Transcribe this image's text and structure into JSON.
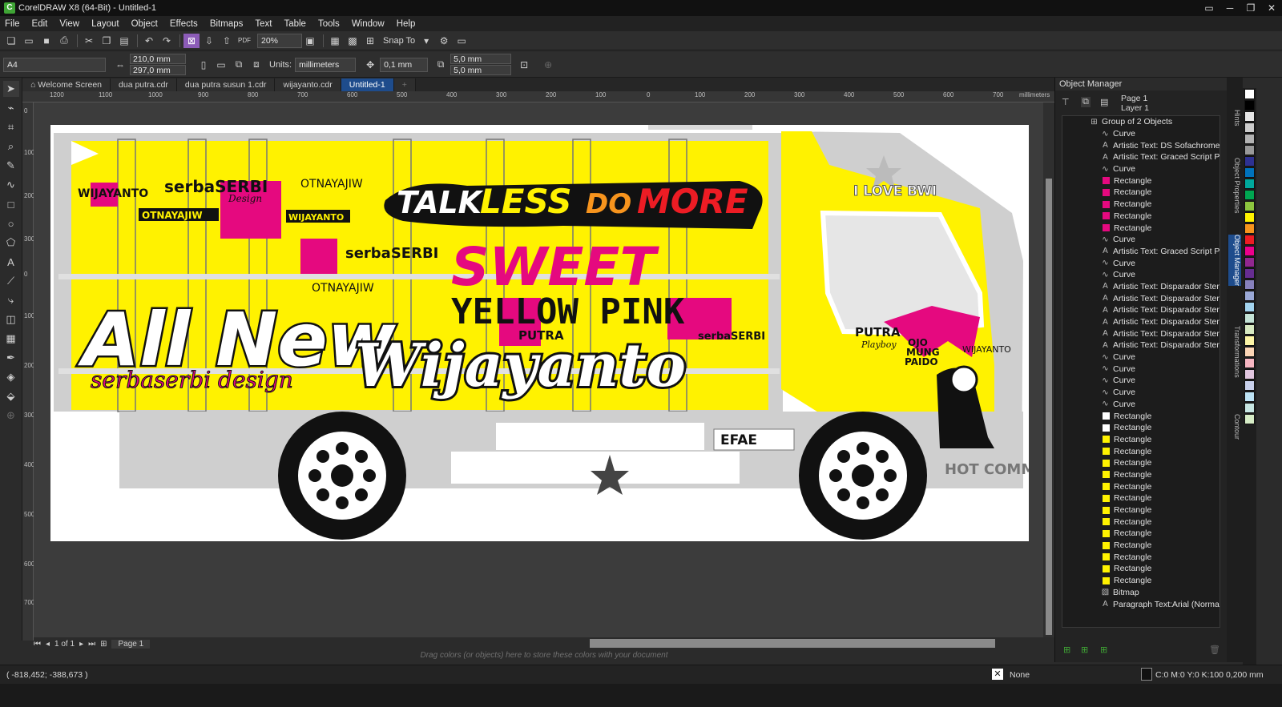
{
  "window": {
    "title": "CorelDRAW X8 (64-Bit) - Untitled-1",
    "controls": [
      "▭",
      "─",
      "❐",
      "✕"
    ]
  },
  "menu": [
    "File",
    "Edit",
    "View",
    "Layout",
    "Object",
    "Effects",
    "Bitmaps",
    "Text",
    "Table",
    "Tools",
    "Window",
    "Help"
  ],
  "toolbar": {
    "zoom": "20%",
    "snap_label": "Snap To"
  },
  "property_bar": {
    "page_size": "A4",
    "width": "210,0 mm",
    "height": "297,0 mm",
    "units_label": "Units:",
    "units": "millimeters",
    "nudge": "0,1 mm",
    "dup_x": "5,0 mm",
    "dup_y": "5,0 mm"
  },
  "doc_tabs": [
    "Welcome Screen",
    "dua putra.cdr",
    "dua putra susun 1.cdr",
    "wijayanto.cdr",
    "Untitled-1"
  ],
  "active_tab": "Untitled-1",
  "ruler": {
    "unit": "millimeters",
    "h_ticks": [
      "1200",
      "1100",
      "1000",
      "900",
      "800",
      "700",
      "600",
      "500",
      "400",
      "300",
      "200",
      "100",
      "0",
      "100",
      "200",
      "300",
      "400",
      "500",
      "600",
      "700"
    ],
    "v_ticks": [
      "0",
      "100",
      "200",
      "300",
      "0",
      "100",
      "200",
      "300",
      "400",
      "500",
      "600",
      "700"
    ]
  },
  "page_nav": {
    "counter": "1 of 1",
    "page_tab": "Page 1"
  },
  "color_well_hint": "Drag colors (or objects) here to store these colors with your document",
  "status": {
    "coords": "( -818,452; -388,673 )",
    "fill": "None",
    "outline": "C:0 M:0 Y:0 K:100  0,200 mm"
  },
  "object_manager": {
    "title": "Object Manager",
    "page": "Page 1",
    "layer": "Layer 1",
    "items": [
      {
        "label": "Group of 2 Objects",
        "kind": "group"
      },
      {
        "label": "Curve",
        "kind": "curve"
      },
      {
        "label": "Artistic Text: DS Sofachrome (",
        "kind": "text"
      },
      {
        "label": "Artistic Text: Graced Script PEF",
        "kind": "text"
      },
      {
        "label": "Curve",
        "kind": "curve"
      },
      {
        "label": "Rectangle",
        "kind": "rect",
        "color": "#e5097f"
      },
      {
        "label": "Rectangle",
        "kind": "rect",
        "color": "#e5097f"
      },
      {
        "label": "Rectangle",
        "kind": "rect",
        "color": "#e5097f"
      },
      {
        "label": "Rectangle",
        "kind": "rect",
        "color": "#e5097f"
      },
      {
        "label": "Rectangle",
        "kind": "rect",
        "color": "#e5097f"
      },
      {
        "label": "Curve",
        "kind": "curve"
      },
      {
        "label": "Artistic Text: Graced Script PEF",
        "kind": "text"
      },
      {
        "label": "Curve",
        "kind": "curve"
      },
      {
        "label": "Curve",
        "kind": "curve"
      },
      {
        "label": "Artistic Text: Disparador Stenc",
        "kind": "text"
      },
      {
        "label": "Artistic Text: Disparador Stenc",
        "kind": "text"
      },
      {
        "label": "Artistic Text: Disparador Stenc",
        "kind": "text"
      },
      {
        "label": "Artistic Text: Disparador Stenc",
        "kind": "text"
      },
      {
        "label": "Artistic Text: Disparador Stenc",
        "kind": "text"
      },
      {
        "label": "Artistic Text: Disparador Stenc",
        "kind": "text"
      },
      {
        "label": "Curve",
        "kind": "curve"
      },
      {
        "label": "Curve",
        "kind": "curve"
      },
      {
        "label": "Curve",
        "kind": "curve"
      },
      {
        "label": "Curve",
        "kind": "curve"
      },
      {
        "label": "Curve",
        "kind": "curve"
      },
      {
        "label": "Rectangle",
        "kind": "rect",
        "color": "#ffffff"
      },
      {
        "label": "Rectangle",
        "kind": "rect",
        "color": "#ffffff"
      },
      {
        "label": "Rectangle",
        "kind": "rect",
        "color": "#fff200"
      },
      {
        "label": "Rectangle",
        "kind": "rect",
        "color": "#fff200"
      },
      {
        "label": "Rectangle",
        "kind": "rect",
        "color": "#fff200"
      },
      {
        "label": "Rectangle",
        "kind": "rect",
        "color": "#fff200"
      },
      {
        "label": "Rectangle",
        "kind": "rect",
        "color": "#fff200"
      },
      {
        "label": "Rectangle",
        "kind": "rect",
        "color": "#fff200"
      },
      {
        "label": "Rectangle",
        "kind": "rect",
        "color": "#fff200"
      },
      {
        "label": "Rectangle",
        "kind": "rect",
        "color": "#fff200"
      },
      {
        "label": "Rectangle",
        "kind": "rect",
        "color": "#fff200"
      },
      {
        "label": "Rectangle",
        "kind": "rect",
        "color": "#fff200"
      },
      {
        "label": "Rectangle",
        "kind": "rect",
        "color": "#fff200"
      },
      {
        "label": "Rectangle",
        "kind": "rect",
        "color": "#fff200"
      },
      {
        "label": "Rectangle",
        "kind": "rect",
        "color": "#fff200"
      },
      {
        "label": "Bitmap",
        "kind": "bitmap"
      },
      {
        "label": "Paragraph Text:Arial (Normal)",
        "kind": "text"
      }
    ]
  },
  "side_tabs": [
    "Hints",
    "Object Properties",
    "Object Manager",
    "Transformations",
    "Contour"
  ],
  "palette": [
    "#ffffff",
    "#000000",
    "#e6e6e6",
    "#cccccc",
    "#b3b3b3",
    "#999999",
    "#2e3192",
    "#0072bc",
    "#00a99d",
    "#00a651",
    "#8dc63f",
    "#fff200",
    "#f7941d",
    "#ed1c24",
    "#ec008c",
    "#92278f",
    "#662d91",
    "#8781bd",
    "#9aa8d6",
    "#a3d4ef",
    "#c4e3d6",
    "#d7e9c1",
    "#fdf5a6",
    "#fcd5b5",
    "#f7b6c2",
    "#e1c6df",
    "#c9d1ec",
    "#bde3f5",
    "#c7e6e2",
    "#d6ecc6"
  ],
  "artwork": {
    "slogan": [
      "TALK",
      "LESS",
      "DO",
      "MORE"
    ],
    "sweet": "SWEET",
    "yellow_pink": "YELLOW PINK",
    "all_new": "All New",
    "script_name": "Wijayanto",
    "sub_script": "serbaserbi design",
    "brand_small": "WIJAYANTO",
    "brand_mirror": "OTNAYAJIW",
    "serba": "serbaSERBI",
    "design": "Design",
    "putra": "PUTRA",
    "playboy": "Playboy",
    "i_love": "I LOVE BWI",
    "hot_comm": "HOT COMM",
    "ojo": [
      "OJO",
      "MUNG",
      "PAIDO"
    ],
    "plate": "EFAE"
  }
}
